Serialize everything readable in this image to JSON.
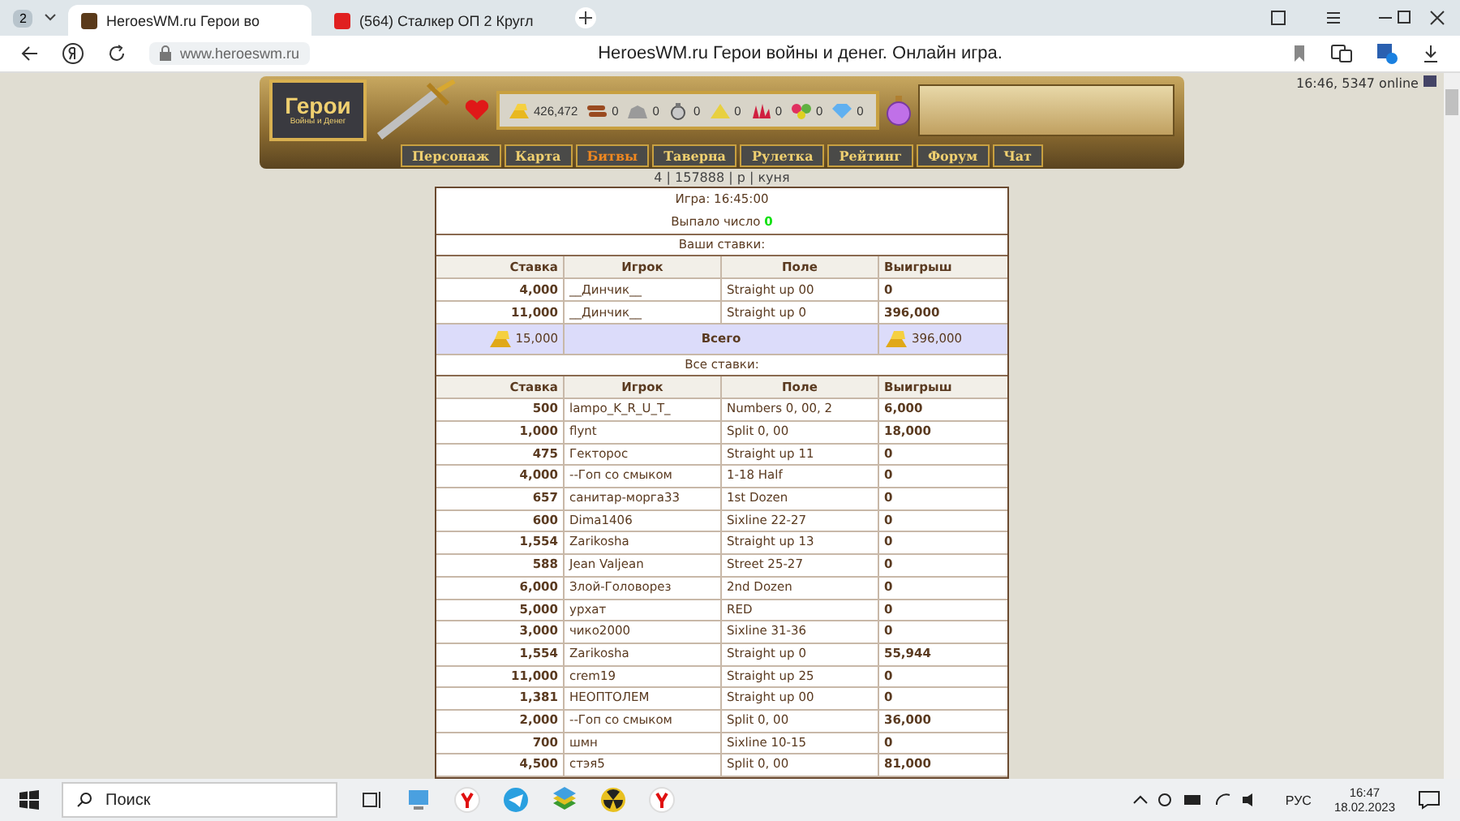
{
  "browser": {
    "tab_count": "2",
    "tabs": [
      {
        "title": "HeroesWM.ru Герои во",
        "selected": true
      },
      {
        "title": "(564) Сталкер ОП 2 Кругл",
        "selected": false
      }
    ],
    "address": "www.heroeswm.ru",
    "page_title": "HeroesWM.ru Герои войны и денег. Онлайн игра."
  },
  "header": {
    "logo_title": "Герои",
    "logo_subtitle": "Войны и Денег",
    "online": "16:46, 5347 online",
    "resources": [
      {
        "kind": "gold",
        "amount": "426,472"
      },
      {
        "kind": "wood",
        "amount": "0"
      },
      {
        "kind": "ore",
        "amount": "0"
      },
      {
        "kind": "mercury",
        "amount": "0"
      },
      {
        "kind": "sulfur",
        "amount": "0"
      },
      {
        "kind": "crystal",
        "amount": "0"
      },
      {
        "kind": "gems",
        "amount": "0"
      },
      {
        "kind": "diamond",
        "amount": "0"
      }
    ],
    "nav": [
      {
        "label": "Персонаж",
        "selected": false
      },
      {
        "label": "Карта",
        "selected": false
      },
      {
        "label": "Битвы",
        "selected": true
      },
      {
        "label": "Таверна",
        "selected": false
      },
      {
        "label": "Рулетка",
        "selected": false
      },
      {
        "label": "Рейтинг",
        "selected": false
      },
      {
        "label": "Форум",
        "selected": false
      },
      {
        "label": "Чат",
        "selected": false
      }
    ]
  },
  "info_line": "4 | 157888 | р | куня",
  "game": {
    "time": "Игра: 16:45:00",
    "result_label": "Выпало число",
    "result_number": "0"
  },
  "your_bets": {
    "title": "Ваши ставки:",
    "columns": [
      "Ставка",
      "Игрок",
      "Поле",
      "Выигрыш"
    ],
    "rows": [
      {
        "stake": "4,000",
        "player": "__Динчик__",
        "field": "Straight up 00",
        "win": "0"
      },
      {
        "stake": "11,000",
        "player": "__Динчик__",
        "field": "Straight up 0",
        "win": "396,000"
      }
    ],
    "total": {
      "stake": "15,000",
      "label": "Всего",
      "win": "396,000"
    }
  },
  "all_bets": {
    "title": "Все ставки:",
    "columns": [
      "Ставка",
      "Игрок",
      "Поле",
      "Выигрыш"
    ],
    "rows": [
      {
        "stake": "500",
        "player": "lampo_K_R_U_T_",
        "field": "Numbers 0, 00, 2",
        "win": "6,000"
      },
      {
        "stake": "1,000",
        "player": "flynt",
        "field": "Split 0, 00",
        "win": "18,000"
      },
      {
        "stake": "475",
        "player": "Гекторос",
        "field": "Straight up 11",
        "win": "0"
      },
      {
        "stake": "4,000",
        "player": "--Гоп со смыком",
        "field": "1-18 Half",
        "win": "0"
      },
      {
        "stake": "657",
        "player": "санитар-морга33",
        "field": "1st Dozen",
        "win": "0"
      },
      {
        "stake": "600",
        "player": "Dima1406",
        "field": "Sixline 22-27",
        "win": "0"
      },
      {
        "stake": "1,554",
        "player": "Zarikosha",
        "field": "Straight up 13",
        "win": "0"
      },
      {
        "stake": "588",
        "player": "Jean Valjean",
        "field": "Street 25-27",
        "win": "0"
      },
      {
        "stake": "6,000",
        "player": "Злой-Головорез",
        "field": "2nd Dozen",
        "win": "0"
      },
      {
        "stake": "5,000",
        "player": "урхат",
        "field": "RED",
        "win": "0"
      },
      {
        "stake": "3,000",
        "player": "чико2000",
        "field": "Sixline 31-36",
        "win": "0"
      },
      {
        "stake": "1,554",
        "player": "Zarikosha",
        "field": "Straight up 0",
        "win": "55,944"
      },
      {
        "stake": "11,000",
        "player": "crem19",
        "field": "Straight up 25",
        "win": "0"
      },
      {
        "stake": "1,381",
        "player": "НЕОПТОЛЕМ",
        "field": "Straight up 00",
        "win": "0"
      },
      {
        "stake": "2,000",
        "player": "--Гоп со смыком",
        "field": "Split 0, 00",
        "win": "36,000"
      },
      {
        "stake": "700",
        "player": "шмн",
        "field": "Sixline 10-15",
        "win": "0"
      },
      {
        "stake": "4,500",
        "player": "стэя5",
        "field": "Split 0, 00",
        "win": "81,000"
      }
    ]
  },
  "taskbar": {
    "search_placeholder": "Поиск",
    "language": "РУС",
    "time": "16:47",
    "date": "18.02.2023"
  }
}
